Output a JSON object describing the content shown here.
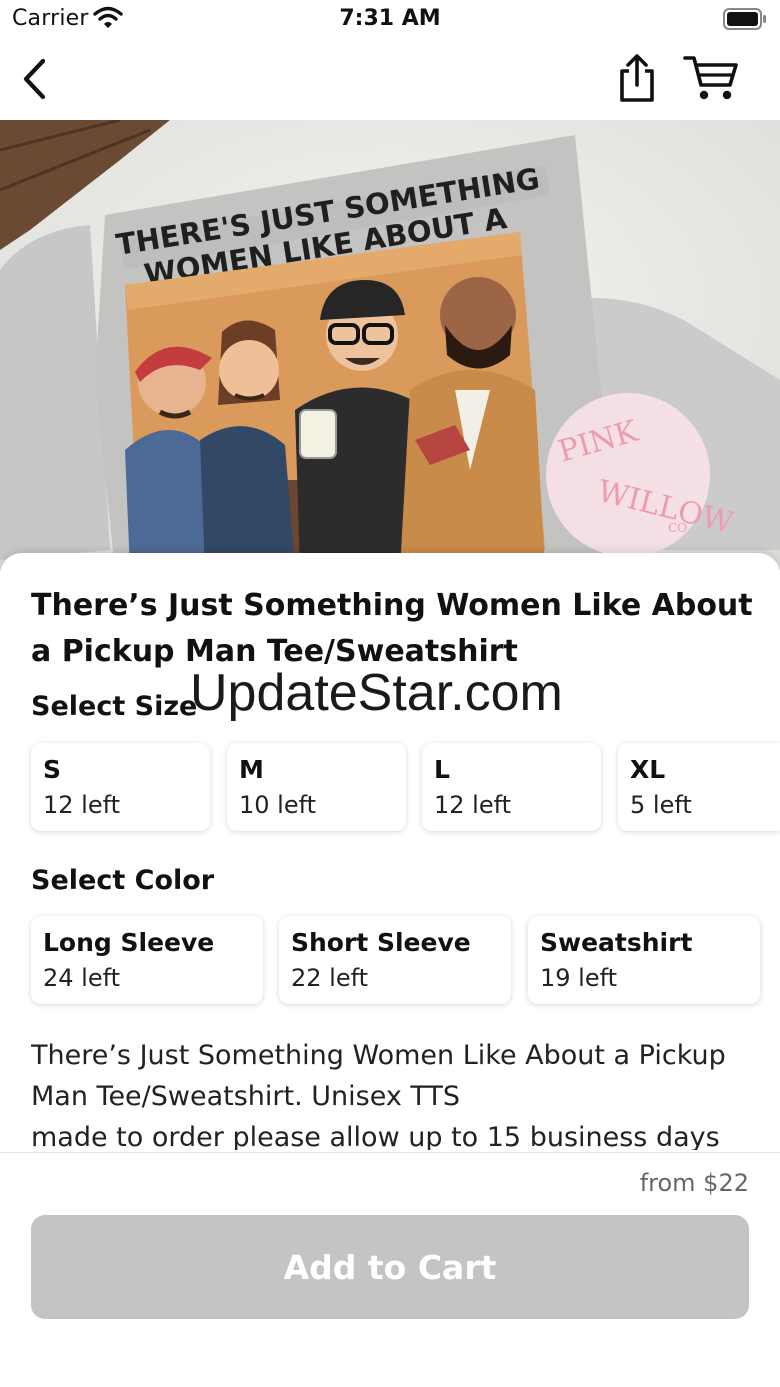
{
  "status_bar": {
    "carrier": "Carrier",
    "time": "7:31 AM"
  },
  "nav": {
    "back_icon": "chevron-left-icon",
    "share_icon": "share-icon",
    "cart_icon": "cart-icon"
  },
  "product_image": {
    "shirt_text_line1": "THERE'S JUST SOMETHING",
    "shirt_text_line2": "WOMEN LIKE ABOUT A",
    "logo_text_1": "PINK",
    "logo_text_2": "WILLOW",
    "logo_text_3": "CO"
  },
  "product": {
    "title": "There’s Just Something Women Like About a Pickup Man Tee/Sweatshirt",
    "description_lines": [
      "There’s Just Something Women Like About a Pickup",
      "Man Tee/Sweatshirt. Unisex TTS",
      "made to order please allow up to 15 business days"
    ],
    "price": "from $22"
  },
  "size_section": {
    "label": "Select Size",
    "options": [
      {
        "name": "S",
        "stock": "12 left"
      },
      {
        "name": "M",
        "stock": "10 left"
      },
      {
        "name": "L",
        "stock": "12 left"
      },
      {
        "name": "XL",
        "stock": "5 left"
      }
    ]
  },
  "color_section": {
    "label": "Select Color",
    "options": [
      {
        "name": "Long Sleeve",
        "stock": "24 left"
      },
      {
        "name": "Short Sleeve",
        "stock": "22 left"
      },
      {
        "name": "Sweatshirt",
        "stock": "19 left"
      }
    ]
  },
  "watermark": "UpdateStar.com",
  "cart_button": {
    "label": "Add to Cart",
    "enabled": false
  },
  "colors": {
    "button_disabled": "#c4c4c4",
    "price_text": "#666666"
  }
}
